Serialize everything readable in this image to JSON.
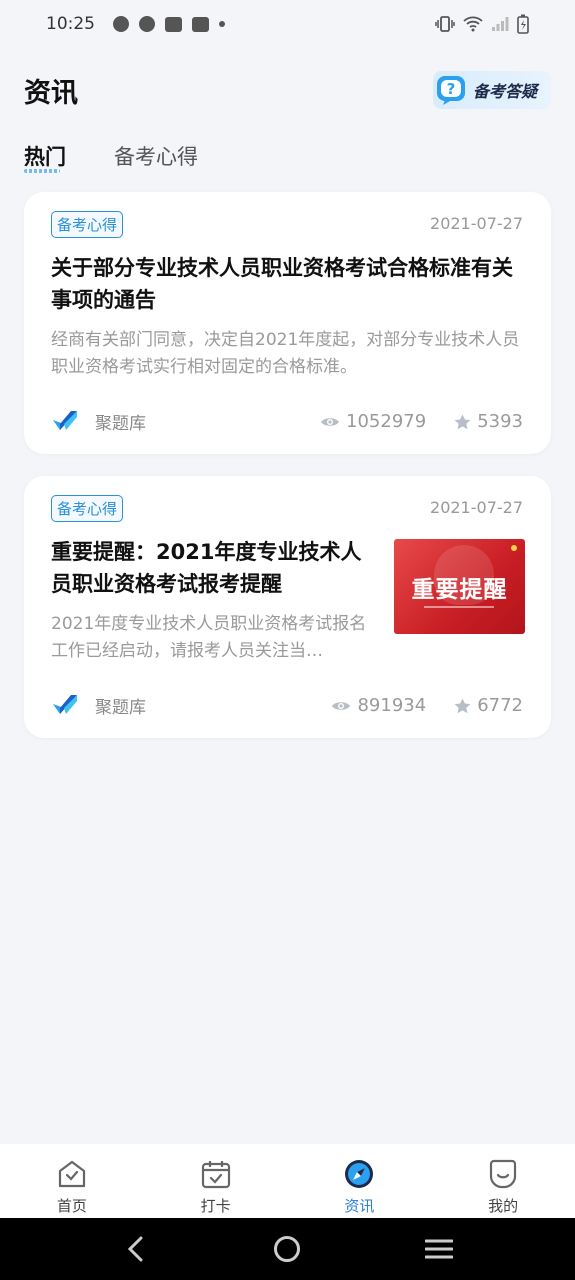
{
  "status_bar": {
    "time": "10:25"
  },
  "header": {
    "title": "资讯",
    "qa_button_label": "备考答疑"
  },
  "tabs": [
    {
      "label": "热门",
      "active": true
    },
    {
      "label": "备考心得",
      "active": false
    }
  ],
  "articles": [
    {
      "tag": "备考心得",
      "date": "2021-07-27",
      "title": "关于部分专业技术人员职业资格考试合格标准有关事项的通告",
      "summary": "经商有关部门同意，决定自2021年度起，对部分专业技术人员职业资格考试实行相对固定的合格标准。",
      "source": "聚题库",
      "views": "1052979",
      "favorites": "5393"
    },
    {
      "tag": "备考心得",
      "date": "2021-07-27",
      "title": "重要提醒：2021年度专业技术人员职业资格考试报考提醒",
      "summary": "2021年度专业技术人员职业资格考试报名工作已经启动，请报考人员关注当…",
      "source": "聚题库",
      "views": "891934",
      "favorites": "6772",
      "thumbnail_text": "重要提醒"
    }
  ],
  "bottom_nav": [
    {
      "label": "首页",
      "icon": "home-icon",
      "active": false
    },
    {
      "label": "打卡",
      "icon": "calendar-check-icon",
      "active": false
    },
    {
      "label": "资讯",
      "icon": "compass-icon",
      "active": true
    },
    {
      "label": "我的",
      "icon": "profile-icon",
      "active": false
    }
  ],
  "colors": {
    "accent": "#2a7ed8",
    "tag": "#2a90d8",
    "background": "#f3f5f9"
  }
}
